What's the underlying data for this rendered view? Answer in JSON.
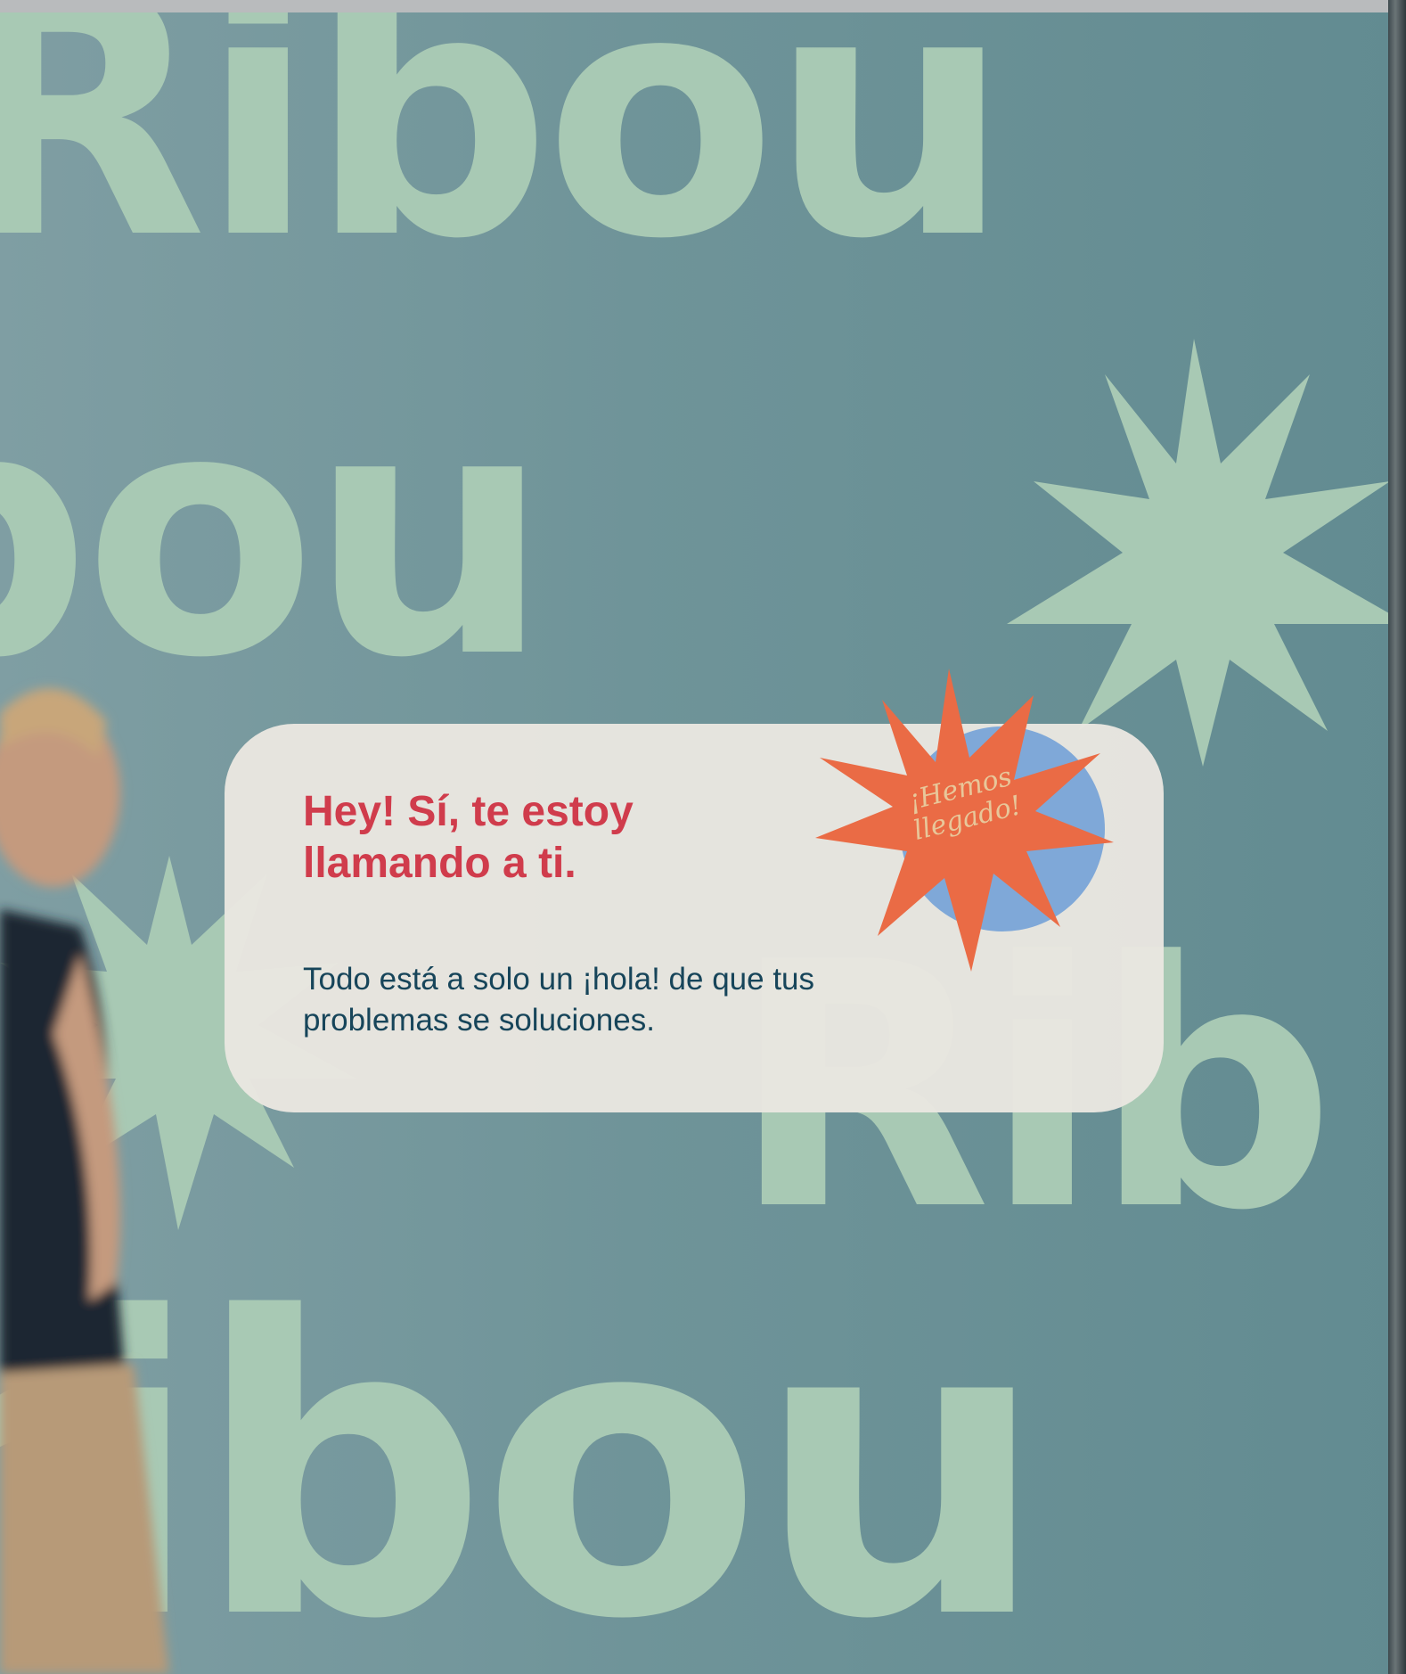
{
  "poster": {
    "headline": "Hey!  Sí, te estoy llamando a ti.",
    "body": "Todo está a solo un ¡hola! de que tus problemas se soluciones.",
    "badge_text": "¡Hemos llegado!"
  },
  "background_wordmark": {
    "row1": "Ribou",
    "row2": "bou",
    "row3": "Rib",
    "row4": "ribou"
  },
  "colors": {
    "wall_teal": "#6f9499",
    "shape_mint": "#a8c9b4",
    "card_cream": "#e9e6e0",
    "headline_red": "#d03c4c",
    "body_navy": "#17455a",
    "starburst_orange": "#ea6b45",
    "circle_blue": "#7fa8d8",
    "badge_text_gold": "#e8c79a"
  }
}
